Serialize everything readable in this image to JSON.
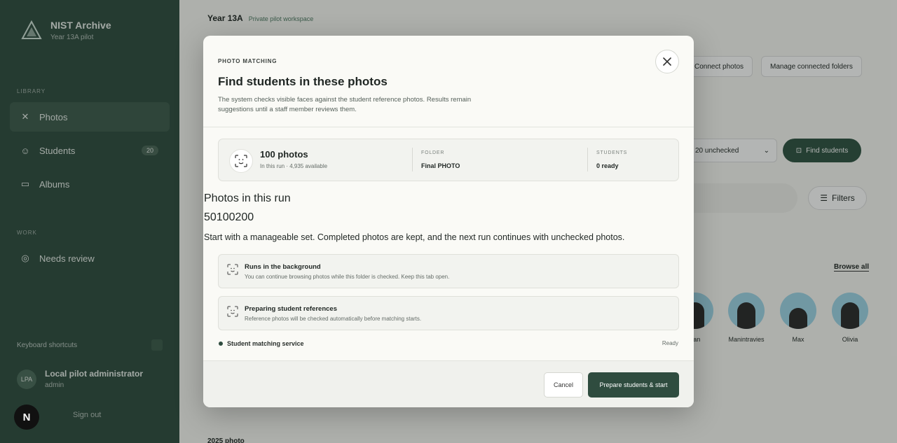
{
  "sidebar": {
    "brand_name": "NIST Archive",
    "brand_sub": "Year 13A pilot",
    "section_library": "LIBRARY",
    "items": [
      {
        "label": "Photos"
      },
      {
        "label": "Students",
        "count": "20"
      },
      {
        "label": "Albums"
      }
    ],
    "section_work": "WORK",
    "review_label": "Needs review",
    "shortcuts_label": "Keyboard shortcuts",
    "user_initials": "LPA",
    "user_name": "Local pilot administrator",
    "user_role": "admin",
    "signout_label": "Sign out",
    "n_badge": "N"
  },
  "main": {
    "title": "Year 13A",
    "subtitle": "Private pilot workspace",
    "connect_label": "Connect photos",
    "manage_label": "Manage connected folders",
    "select_value": "20 unchecked",
    "find_label": "Find students",
    "filters_label": "Filters",
    "browse_label": "Browse all",
    "people": [
      {
        "name": "Jan"
      },
      {
        "name": "Manintravies"
      },
      {
        "name": "Max"
      },
      {
        "name": "Olivia"
      }
    ],
    "footer_text": "2025 photo"
  },
  "modal": {
    "eyebrow": "PHOTO MATCHING",
    "title": "Find students in these photos",
    "description": "The system checks visible faces against the student reference photos. Results remain suggestions until a staff member reviews them.",
    "summary": {
      "count": "100 photos",
      "meta": "In this run · 4,935 available",
      "folder_label": "FOLDER",
      "folder_value": "Final PHOTO",
      "students_label": "STUDENTS",
      "students_value": "0 ready"
    },
    "run_label": "Photos in this run",
    "run_value": "50100200",
    "run_help": "Start with a manageable set. Completed photos are kept, and the next run continues with unchecked photos.",
    "cards": [
      {
        "title": "Runs in the background",
        "text": "You can continue browsing photos while this folder is checked. Keep this tab open."
      },
      {
        "title": "Preparing student references",
        "text": "Reference photos will be checked automatically before matching starts."
      }
    ],
    "service_label": "Student matching service",
    "service_status": "Ready",
    "cancel_label": "Cancel",
    "primary_label": "Prepare students & start"
  },
  "colors": {
    "sidebar": "#2f4c3f",
    "accent": "#2f4c3f",
    "modal_bg": "#fafaf6"
  }
}
